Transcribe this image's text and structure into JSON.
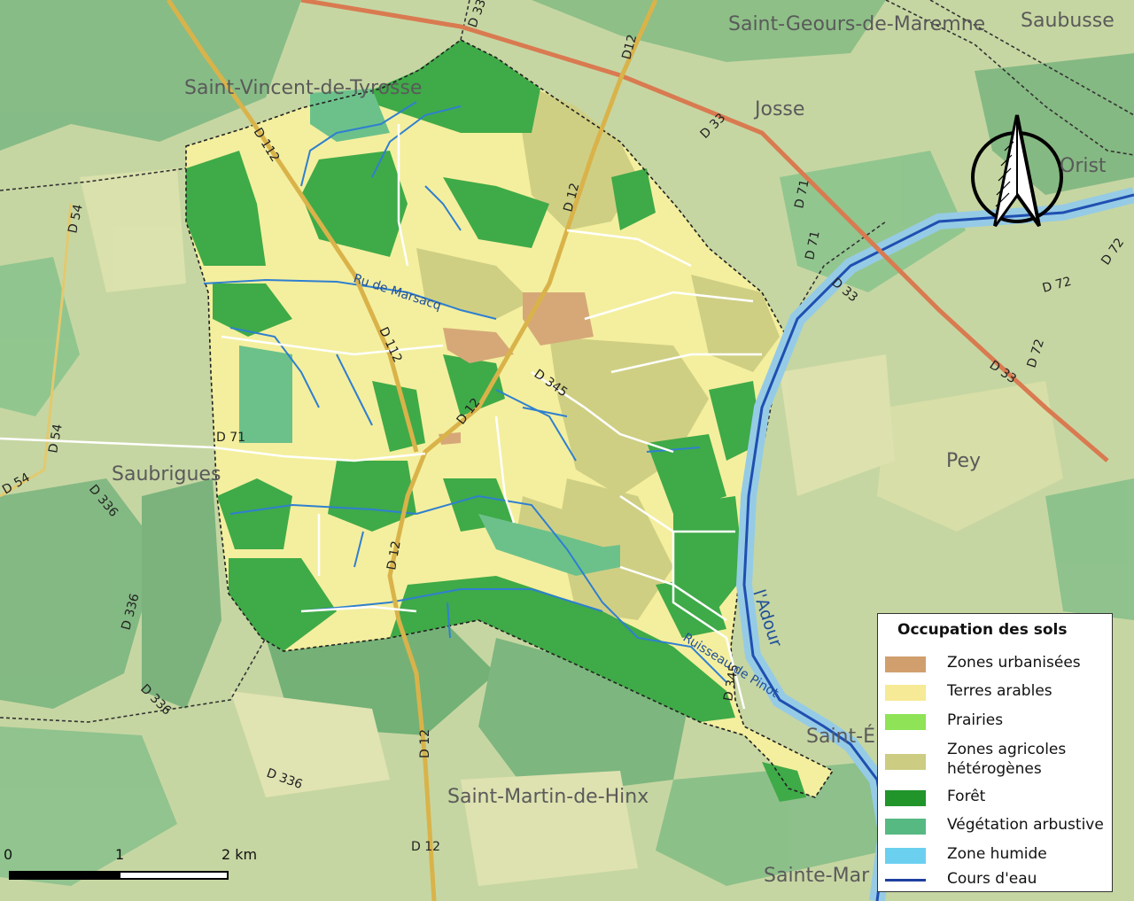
{
  "places": {
    "saint_geours": "Saint-Geours-de-Maremne",
    "saubusse": "Saubusse",
    "saint_vincent": "Saint-Vincent-de-Tyrosse",
    "josse": "Josse",
    "orist": "Orist",
    "saubrigues": "Saubrigues",
    "pey": "Pey",
    "saint_martin": "Saint-Martin-de-Hinx",
    "saint_e": "Saint-É",
    "sainte_mar": "Sainte-Mar"
  },
  "roads": {
    "d33_top": "D 33",
    "d12_top": "D12",
    "d33_josse": "D 33",
    "d71_a": "D 71",
    "d71_b": "D 71",
    "d33_mid": "D 33",
    "d72_a": "D 72",
    "d72_b": "D 72",
    "d72_c": "D 72",
    "d33_right": "D 33",
    "d112_a": "D 112",
    "d12_a": "D 12",
    "d112_b": "D 112",
    "d345_a": "D 345",
    "d12_b": "D 12",
    "d71_left": "D 71",
    "d12_c": "D 12",
    "d54_a": "D 54",
    "d54_b": "D 54",
    "d54_c": "D 54",
    "d336_a": "D 336",
    "d336_b": "D 336",
    "d336_c": "D 336",
    "d336_d": "D 336",
    "d345_b": "D 345",
    "d12_d": "D 12",
    "d12_e": "D 12"
  },
  "water": {
    "ru_marsacq": "Ru de Marsacq",
    "ruisseau_pinot": "Ruisseau de Pinot",
    "adour": "l'Adour"
  },
  "legend": {
    "title": "Occupation des sols",
    "items": [
      {
        "label": "Zones urbanisées",
        "color": "#d19f6d"
      },
      {
        "label": "Terres arables",
        "color": "#f7ea96"
      },
      {
        "label": "Prairies",
        "color": "#8ee356"
      },
      {
        "label": "Zones agricoles\nhétérogènes",
        "color": "#cccd82"
      },
      {
        "label": "Forêt",
        "color": "#21942a"
      },
      {
        "label": "Végétation arbustive",
        "color": "#56b982"
      },
      {
        "label": "Zone humide",
        "color": "#6bd0f0"
      },
      {
        "label": "Cours d'eau",
        "color": "#1f3fa0",
        "line": true
      }
    ]
  },
  "scale": {
    "labels": [
      "0",
      "1",
      "2 km"
    ]
  },
  "north_arrow": "north-arrow-icon"
}
